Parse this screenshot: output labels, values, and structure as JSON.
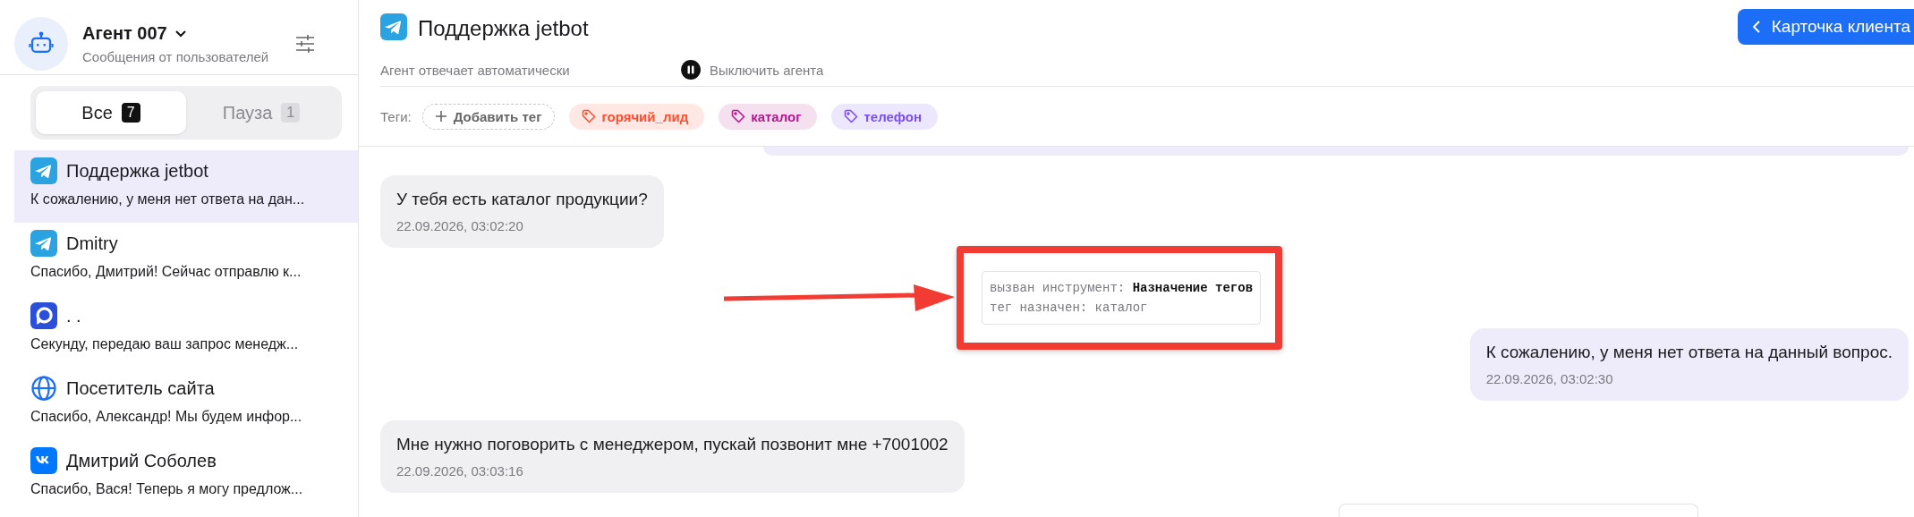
{
  "agent": {
    "name": "Агент 007",
    "subtitle": "Сообщения от пользователей"
  },
  "filter_tabs": [
    {
      "label": "Все",
      "count": "7",
      "selected": true
    },
    {
      "label": "Пауза",
      "count": "1",
      "selected": false
    }
  ],
  "chats": [
    {
      "kind": "telegram",
      "name": "Поддержка jetbot",
      "preview": "К сожалению, у меня нет ответа на дан...",
      "selected": true
    },
    {
      "kind": "telegram",
      "name": "Dmitry",
      "preview": "Спасибо, Дмитрий! Сейчас отправлю к...",
      "selected": false
    },
    {
      "kind": "chat",
      "name": ". .",
      "preview": "Секунду, передаю ваш запрос менедж...",
      "selected": false
    },
    {
      "kind": "web",
      "name": "Посетитель сайта",
      "preview": "Спасибо, Александр! Мы будем инфор...",
      "selected": false
    },
    {
      "kind": "vk",
      "name": "Дмитрий Соболев",
      "preview": "Спасибо, Вася! Теперь я могу предлож...",
      "selected": false
    }
  ],
  "header": {
    "title": "Поддержка jetbot",
    "status": "Агент отвечает автоматически",
    "pause_action": "Выключить агента",
    "client_card_button": "Карточка клиента"
  },
  "tags": {
    "label": "Теги:",
    "add_button": "Добавить тег",
    "items": [
      {
        "label": "горячий_лид",
        "color": "#ff4d2e"
      },
      {
        "label": "каталог",
        "color": "#b5178f"
      },
      {
        "label": "телефон",
        "color": "#7a4df0"
      }
    ]
  },
  "messages": [
    {
      "kind": "incoming",
      "text": "У тебя есть каталог продукции?",
      "time": "22.09.2026, 03:02:20"
    },
    {
      "kind": "tool",
      "lines": [
        "вызван инструмент: **Назначение тегов**",
        "тег назначен: каталог"
      ]
    },
    {
      "kind": "outgoing",
      "text": "К сожалению, у меня нет ответа на данный вопрос.",
      "time": "22.09.2026, 03:02:30"
    },
    {
      "kind": "incoming",
      "text": "Мне  нужно поговорить с менеджером, пускай позвонит мне +7001002",
      "time": "22.09.2026, 03:03:16"
    }
  ]
}
